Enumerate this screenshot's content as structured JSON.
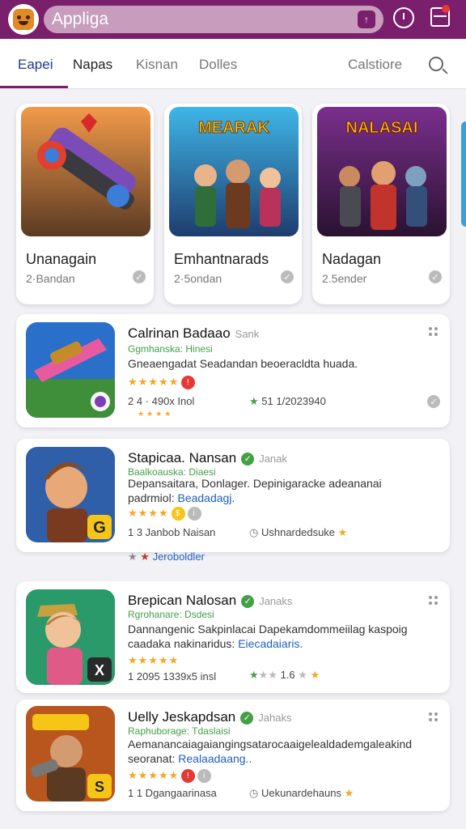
{
  "header": {
    "app_title": "Appliga",
    "logo_icon": "app-logo-icon"
  },
  "tabs": [
    {
      "label": "Eapei"
    },
    {
      "label": "Napas"
    },
    {
      "label": "Kisnan"
    },
    {
      "label": "Dolles"
    },
    {
      "label": "Calstiore"
    }
  ],
  "featured": [
    {
      "name": "Unanagain",
      "downloads": "2·Bandan"
    },
    {
      "name": "Emhantnarads",
      "downloads": "2·5ondan"
    },
    {
      "name": "Nadagan",
      "downloads": "2.5ender"
    }
  ],
  "featured_art": [
    {
      "banner": ""
    },
    {
      "banner": "MEARAK"
    },
    {
      "banner": "NALASAI"
    }
  ],
  "items": [
    {
      "title": "Calrinan Badaao",
      "tag": "Sank",
      "subtitle": "Ggmhanska: Hinesi",
      "desc_plain": "Gneaengadat Seadandan beoeracldta huada.",
      "desc_link": "",
      "meta_left": "2 4 · 490x Inol",
      "meta_right": "51 1/2023940"
    },
    {
      "title": "Stapicaa. Nansan",
      "tag": "Janak",
      "subtitle": "Baalkoauska: Diaesi",
      "desc_plain": "Depansaitara, Donlager. Depinigaracke adeananai padrmiol:",
      "desc_link": "Beadadagj.",
      "meta_left": "1 3 Janbob Naisan",
      "meta_right": "Ushnardedsuke"
    },
    {
      "title": "Brepican Nalosan",
      "tag": "Janaks",
      "subtitle": "Rgrohanare: Dsdesi",
      "desc_plain": "Dannangenic Sakpinlacai Dapekamdommeiilag kaspoig caadaka nakinaridus:",
      "desc_link": "Eiecadaiaris.",
      "meta_left": "1 2095 1339x5 insl",
      "meta_right": "1.6"
    },
    {
      "title": "Uelly Jeskapdsan",
      "tag": "Jahaks",
      "subtitle": "Raphuborage: Tdaslaisi",
      "desc_plain": "Aemanancaiagaiangingsatarocaaigelealdademgaleakind seoranat:",
      "desc_link": "Realaadaang..",
      "meta_left": "1 1 Dgangaarinasa",
      "meta_right": "Uekunardehauns"
    }
  ],
  "floating_link": "Jeroboldler",
  "colors": {
    "brand": "#7a1f6b",
    "tab_active": "#1f3b8c",
    "verified": "#43a047",
    "star": "#f5a623"
  }
}
